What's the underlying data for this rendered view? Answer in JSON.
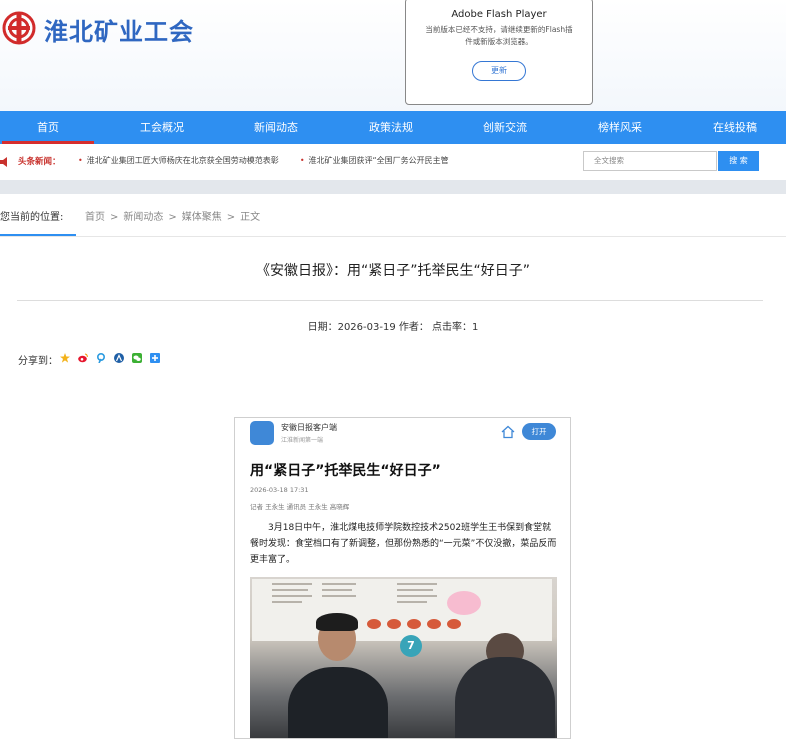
{
  "header": {
    "site_title": "淮北矿业工会",
    "brand_color": "#2f67c1"
  },
  "flash_notice": {
    "title": "Adobe Flash Player",
    "description": "当前版本已经不支持，请继续更新的Flash插件或新版本浏览器。",
    "button_label": "更新"
  },
  "nav": {
    "bg_color": "#2e8ff1",
    "active_indicator_color": "#d62e2e",
    "items": [
      {
        "label": "首页",
        "active": true
      },
      {
        "label": "工会概况"
      },
      {
        "label": "新闻动态"
      },
      {
        "label": "政策法规"
      },
      {
        "label": "创新交流"
      },
      {
        "label": "榜样风采"
      },
      {
        "label": "在线投稿"
      }
    ]
  },
  "headline_bar": {
    "label": "头条新闻：",
    "items": [
      "淮北矿业集团工匠大师杨庆在北京获全国劳动模范表彰",
      "淮北矿业集团获评“全国厂务公开民主管"
    ]
  },
  "search": {
    "placeholder": "全文搜索",
    "button_label": "搜 索"
  },
  "breadcrumb": {
    "label": "您当前的位置:",
    "items": [
      "首页",
      "新闻动态",
      "媒体聚焦",
      "正文"
    ],
    "separator": ">"
  },
  "article": {
    "title": "《安徽日报》：用“紧日子”托举民生“好日子”",
    "meta": "日期：2026-03-19 作者：  点击率：1",
    "share_label": "分享到：",
    "share_icons": [
      "qzone-icon",
      "weibo-icon",
      "tencent-weibo-icon",
      "renren-icon",
      "wechat-icon",
      "more-share-icon"
    ]
  },
  "embedded_screenshot": {
    "app_name": "安徽日报客户端",
    "app_slogan": "江淮新闻第一端",
    "open_button": "打开",
    "headline": "用“紧日子”托举民生“好日子”",
    "date": "2026-03-18 17:31",
    "byline": "记者 王永生 通讯员 王永生 高晓辉",
    "body": "3月18日中午，淮北煤电技师学院数控技术2502班学生王书保到食堂就餐时发现：食堂档口有了新调整，但那份熟悉的“一元菜”不仅没撤，菜品反而更丰富了。",
    "photo_tag_number": "7"
  }
}
